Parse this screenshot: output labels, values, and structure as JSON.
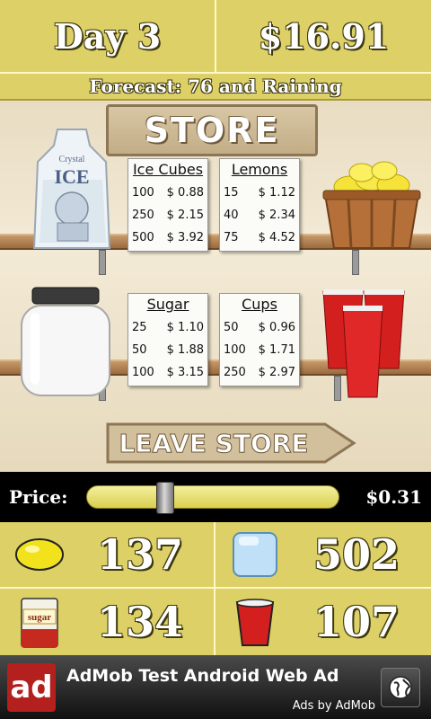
{
  "header": {
    "day": "Day 3",
    "money": "$16.91"
  },
  "forecast": "Forecast: 76 and Raining",
  "store": {
    "title": "STORE",
    "leave_label": "LEAVE STORE",
    "cards": {
      "ice": {
        "title": "Ice Cubes",
        "rows": [
          {
            "qty": "100",
            "price": "$ 0.88"
          },
          {
            "qty": "250",
            "price": "$ 2.15"
          },
          {
            "qty": "500",
            "price": "$ 3.92"
          }
        ]
      },
      "lemons": {
        "title": "Lemons",
        "rows": [
          {
            "qty": "15",
            "price": "$ 1.12"
          },
          {
            "qty": "40",
            "price": "$ 2.34"
          },
          {
            "qty": "75",
            "price": "$ 4.52"
          }
        ]
      },
      "sugar": {
        "title": "Sugar",
        "rows": [
          {
            "qty": "25",
            "price": "$ 1.10"
          },
          {
            "qty": "50",
            "price": "$ 1.88"
          },
          {
            "qty": "100",
            "price": "$ 3.15"
          }
        ]
      },
      "cups": {
        "title": "Cups",
        "rows": [
          {
            "qty": "50",
            "price": "$ 0.96"
          },
          {
            "qty": "100",
            "price": "$ 1.71"
          },
          {
            "qty": "250",
            "price": "$ 2.97"
          }
        ]
      }
    },
    "ice_bag_brand": "Crystal",
    "ice_bag_label": "ICE",
    "sugar_icon_label": "sugar"
  },
  "price": {
    "label": "Price:",
    "value": "$0.31",
    "slider_fraction": 0.31
  },
  "inventory": {
    "lemons": "137",
    "ice": "502",
    "sugar": "134",
    "cups": "107"
  },
  "ad": {
    "logo": "ad",
    "title": "AdMob Test Android Web Ad",
    "subtitle": "Ads by AdMob"
  },
  "colors": {
    "panel_yellow": "#dcd066",
    "cup_red": "#d41f1f",
    "lemon_yellow": "#f2e21b"
  },
  "icons": {
    "lemon": "lemon-icon",
    "ice": "ice-cube-icon",
    "sugar": "sugar-bag-icon",
    "cup": "red-cup-icon",
    "globe": "globe-icon"
  }
}
